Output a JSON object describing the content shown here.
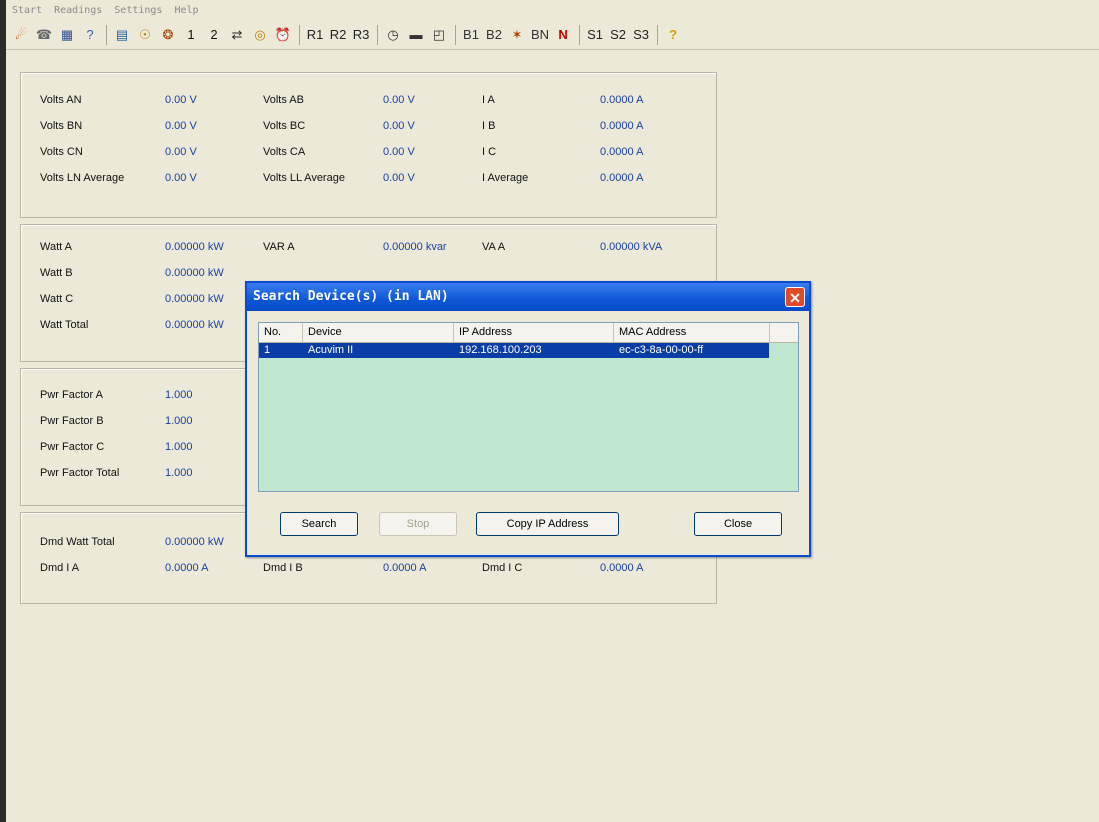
{
  "menu": [
    "Start",
    "Readings",
    "Settings",
    "Help"
  ],
  "toolbar": {
    "items": [
      {
        "name": "connect-icon",
        "glyph": "☄",
        "color": "#c03000"
      },
      {
        "name": "disconnect-icon",
        "glyph": "☎",
        "color": "#6a6a6a"
      },
      {
        "name": "device-info-icon",
        "glyph": "▦",
        "color": "#2f4f8f"
      },
      {
        "name": "what-is-this-icon",
        "glyph": "?",
        "color": "#3060b0"
      },
      {
        "name": "meter-icon",
        "glyph": "▤",
        "color": "#2060a0"
      },
      {
        "name": "bulb-icon",
        "glyph": "☉",
        "color": "#b08000"
      },
      {
        "name": "bug-icon",
        "glyph": "❂",
        "color": "#a04000"
      },
      {
        "name": "text-1",
        "glyph": "1",
        "color": "#111111"
      },
      {
        "name": "text-2",
        "glyph": "2",
        "color": "#111111"
      },
      {
        "name": "transfer-icon",
        "glyph": "⇄",
        "color": "#2a2a2a"
      },
      {
        "name": "target-icon",
        "glyph": "◎",
        "color": "#c08000"
      },
      {
        "name": "alarm-icon",
        "glyph": "⏰",
        "color": "#c03000"
      },
      {
        "name": "r1-label",
        "glyph": "R1",
        "color": "#222222"
      },
      {
        "name": "r2-label",
        "glyph": "R2",
        "color": "#222222"
      },
      {
        "name": "r3-label",
        "glyph": "R3",
        "color": "#222222"
      },
      {
        "name": "clock-icon",
        "glyph": "◷",
        "color": "#333333"
      },
      {
        "name": "memory-icon",
        "glyph": "▬",
        "color": "#333333"
      },
      {
        "name": "export-icon",
        "glyph": "◰",
        "color": "#333333"
      },
      {
        "name": "b1-label",
        "glyph": "B1",
        "color": "#333333"
      },
      {
        "name": "b2-label",
        "glyph": "B2",
        "color": "#333333"
      },
      {
        "name": "special-icon",
        "glyph": "✶",
        "color": "#b04000"
      },
      {
        "name": "bn-label",
        "glyph": "BN",
        "color": "#333333"
      },
      {
        "name": "n-label",
        "glyph": "N",
        "color": "#c30000"
      },
      {
        "name": "s1-label",
        "glyph": "S1",
        "color": "#222222"
      },
      {
        "name": "s2-label",
        "glyph": "S2",
        "color": "#222222"
      },
      {
        "name": "s3-label",
        "glyph": "S3",
        "color": "#222222"
      },
      {
        "name": "help-icon",
        "glyph": "?",
        "color": "#d8a000"
      }
    ]
  },
  "voltage": {
    "rows": [
      {
        "l1": "Volts AN",
        "v1": "0.00 V",
        "l2": "Volts AB",
        "v2": "0.00 V",
        "l3": "I A",
        "v3": "0.0000 A"
      },
      {
        "l1": "Volts BN",
        "v1": "0.00 V",
        "l2": "Volts BC",
        "v2": "0.00 V",
        "l3": "I B",
        "v3": "0.0000 A"
      },
      {
        "l1": "Volts CN",
        "v1": "0.00 V",
        "l2": "Volts CA",
        "v2": "0.00 V",
        "l3": "I C",
        "v3": "0.0000 A"
      },
      {
        "l1": "Volts LN Average",
        "v1": "0.00 V",
        "l2": "Volts LL Average",
        "v2": "0.00 V",
        "l3": "I Average",
        "v3": "0.0000 A"
      }
    ]
  },
  "power": {
    "rows": [
      {
        "l1": "Watt A",
        "v1": "0.00000 kW",
        "l2": "VAR A",
        "v2": "0.00000 kvar",
        "l3": "VA A",
        "v3": "0.00000 kVA"
      },
      {
        "l1": "Watt B",
        "v1": "0.00000 kW"
      },
      {
        "l1": "Watt C",
        "v1": "0.00000 kW"
      },
      {
        "l1": "Watt Total",
        "v1": "0.00000 kW"
      }
    ]
  },
  "pf": {
    "rows": [
      {
        "l1": "Pwr Factor A",
        "v1": "1.000"
      },
      {
        "l1": "Pwr Factor B",
        "v1": "1.000"
      },
      {
        "l1": "Pwr Factor C",
        "v1": "1.000"
      },
      {
        "l1": "Pwr Factor Total",
        "v1": "1.000"
      }
    ]
  },
  "demand": {
    "rows": [
      {
        "l1": "Dmd Watt Total",
        "v1": "0.00000 kW"
      },
      {
        "l1": "Dmd I A",
        "v1": "0.0000 A",
        "l2": "Dmd I B",
        "v2": "0.0000 A",
        "l3": "Dmd I C",
        "v3": "0.0000 A"
      }
    ]
  },
  "dialog": {
    "title": "Search Device(s) (in LAN)",
    "close_glyph": "✕",
    "columns": [
      "No.",
      "Device",
      "IP Address",
      "MAC Address"
    ],
    "rows": [
      {
        "no": "1",
        "device": "Acuvim II",
        "ip": "192.168.100.203",
        "mac": "ec-c3-8a-00-00-ff"
      }
    ],
    "buttons": {
      "search": "Search",
      "stop": "Stop",
      "copy": "Copy IP Address",
      "close": "Close"
    }
  }
}
